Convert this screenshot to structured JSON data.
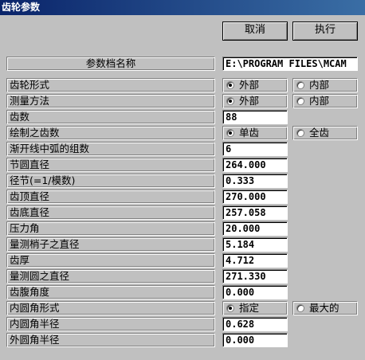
{
  "window": {
    "title": "齿轮参数"
  },
  "buttons": {
    "cancel": "取消",
    "execute": "执行"
  },
  "param_file": {
    "label": "参数档名称",
    "value": "E:\\PROGRAM FILES\\MCAM"
  },
  "rows": {
    "gear_type": {
      "label": "齿轮形式",
      "options": [
        {
          "label": "外部",
          "selected": true
        },
        {
          "label": "内部",
          "selected": false
        }
      ]
    },
    "measure_method": {
      "label": "测量方法",
      "options": [
        {
          "label": "外部",
          "selected": true
        },
        {
          "label": "内部",
          "selected": false
        }
      ]
    },
    "teeth_count": {
      "label": "齿数",
      "value": "88"
    },
    "draw_teeth": {
      "label": "绘制之齿数",
      "options": [
        {
          "label": "单齿",
          "selected": true
        },
        {
          "label": "全齿",
          "selected": false
        }
      ]
    },
    "involute_arcs": {
      "label": "渐开线中弧的组数",
      "value": "6"
    },
    "pitch_diameter": {
      "label": "节圆直径",
      "value": "264.000"
    },
    "diametral_pitch": {
      "label": "径节(=1/模数)",
      "value": "0.333"
    },
    "tip_diameter": {
      "label": "齿顶直径",
      "value": "270.000"
    },
    "root_diameter": {
      "label": "齿底直径",
      "value": "257.058"
    },
    "pressure_angle": {
      "label": "压力角",
      "value": "20.000"
    },
    "pin_diameter": {
      "label": "量测梢子之直径",
      "value": "5.184"
    },
    "tooth_thickness": {
      "label": "齿厚",
      "value": "4.712"
    },
    "measure_circle": {
      "label": "量测圆之直径",
      "value": "271.330"
    },
    "flank_angle": {
      "label": "齿腹角度",
      "value": "0.000"
    },
    "fillet_type": {
      "label": "内圆角形式",
      "options": [
        {
          "label": "指定",
          "selected": true
        },
        {
          "label": "最大的",
          "selected": false
        }
      ]
    },
    "inner_fillet_radius": {
      "label": "内圆角半径",
      "value": "0.628"
    },
    "outer_fillet_radius": {
      "label": "外圆角半径",
      "value": "0.000"
    }
  }
}
